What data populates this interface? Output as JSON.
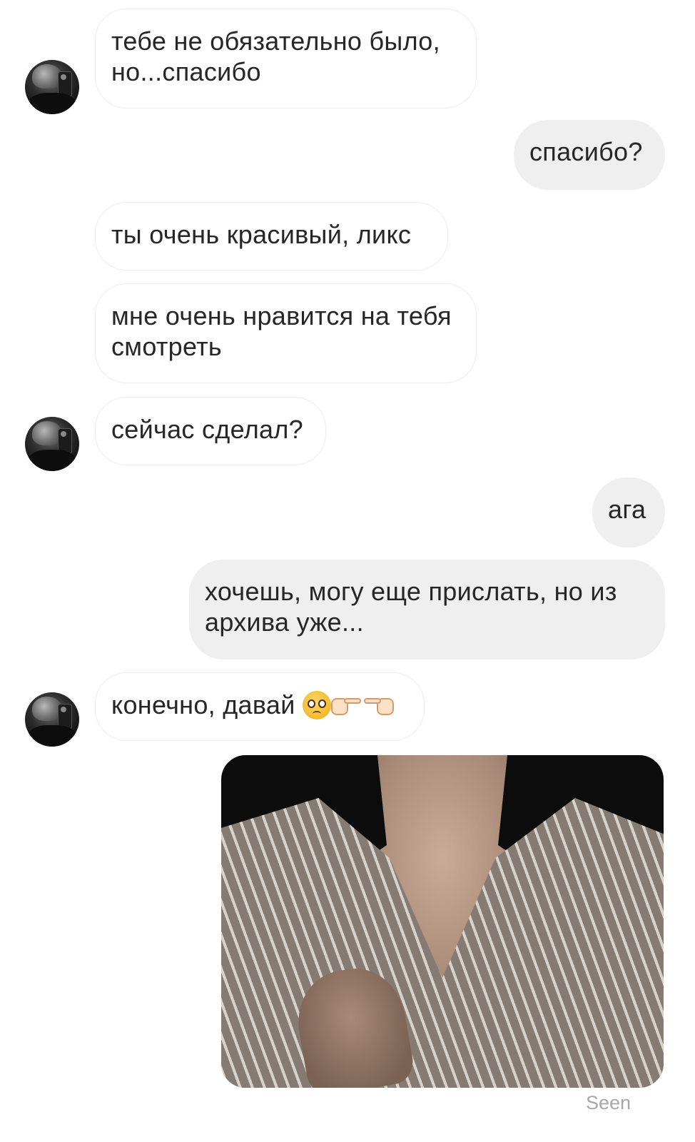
{
  "messages": [
    {
      "direction": "incoming",
      "text": "тебе не обязательно было, но...спасибо",
      "avatar": true
    },
    {
      "direction": "outgoing",
      "text": "спасибо?"
    },
    {
      "direction": "incoming",
      "text": "ты очень красивый, ликс",
      "avatar": false
    },
    {
      "direction": "incoming",
      "text": "мне очень нравится на тебя смотреть",
      "avatar": false
    },
    {
      "direction": "incoming",
      "text": "сейчас сделал?",
      "avatar": true
    },
    {
      "direction": "outgoing",
      "text": "ага"
    },
    {
      "direction": "outgoing",
      "text": "хочешь, могу еще прислать, но из архива уже..."
    },
    {
      "direction": "incoming",
      "text": "конечно, давай",
      "emojis": [
        "pleading-face",
        "backhand-index-pointing-right",
        "backhand-index-pointing-left"
      ],
      "avatar": true
    },
    {
      "direction": "outgoing",
      "type": "photo",
      "image": "photo-of-person-in-striped-shirt"
    }
  ],
  "status": {
    "seen": "Seen"
  },
  "colors": {
    "incoming_bubble": "#ffffff",
    "incoming_border": "#ececec",
    "outgoing_bubble": "#efefef",
    "text": "#262626",
    "seen_text": "#a8a8a8"
  }
}
